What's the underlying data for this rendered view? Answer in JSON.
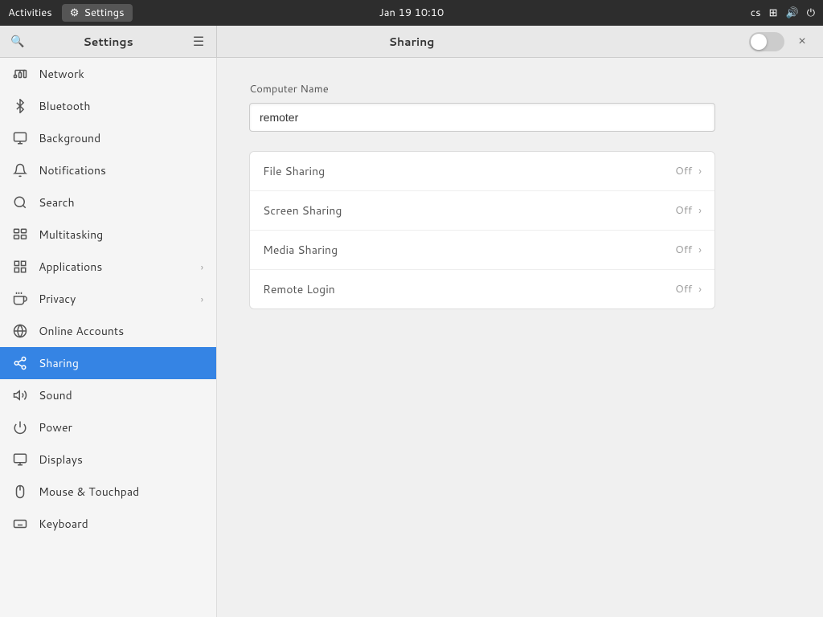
{
  "topbar": {
    "activities_label": "Activities",
    "settings_icon": "⚙",
    "settings_label": "Settings",
    "datetime": "Jan 19  10:10",
    "user": "cs",
    "network_icon": "⊞",
    "volume_icon": "🔊",
    "power_icon": "⏻"
  },
  "sidebar_header": {
    "title": "Settings",
    "search_icon": "🔍",
    "menu_icon": "☰"
  },
  "content_header": {
    "title": "Sharing",
    "close_label": "×"
  },
  "sidebar": {
    "items": [
      {
        "id": "network",
        "label": "Network",
        "icon": "network"
      },
      {
        "id": "bluetooth",
        "label": "Bluetooth",
        "icon": "bluetooth"
      },
      {
        "id": "background",
        "label": "Background",
        "icon": "background"
      },
      {
        "id": "notifications",
        "label": "Notifications",
        "icon": "notifications"
      },
      {
        "id": "search",
        "label": "Search",
        "icon": "search"
      },
      {
        "id": "multitasking",
        "label": "Multitasking",
        "icon": "multitasking"
      },
      {
        "id": "applications",
        "label": "Applications",
        "icon": "applications",
        "has_chevron": true
      },
      {
        "id": "privacy",
        "label": "Privacy",
        "icon": "privacy",
        "has_chevron": true
      },
      {
        "id": "online-accounts",
        "label": "Online Accounts",
        "icon": "online-accounts"
      },
      {
        "id": "sharing",
        "label": "Sharing",
        "icon": "sharing",
        "active": true
      },
      {
        "id": "sound",
        "label": "Sound",
        "icon": "sound"
      },
      {
        "id": "power",
        "label": "Power",
        "icon": "power"
      },
      {
        "id": "displays",
        "label": "Displays",
        "icon": "displays"
      },
      {
        "id": "mouse-touchpad",
        "label": "Mouse & Touchpad",
        "icon": "mouse"
      },
      {
        "id": "keyboard",
        "label": "Keyboard",
        "icon": "keyboard"
      }
    ]
  },
  "main": {
    "computer_name_label": "Computer Name",
    "computer_name_value": "remoter",
    "sharing_items": [
      {
        "id": "file-sharing",
        "label": "File Sharing",
        "status": "Off"
      },
      {
        "id": "screen-sharing",
        "label": "Screen Sharing",
        "status": "Off"
      },
      {
        "id": "media-sharing",
        "label": "Media Sharing",
        "status": "Off"
      },
      {
        "id": "remote-login",
        "label": "Remote Login",
        "status": "Off"
      }
    ]
  }
}
